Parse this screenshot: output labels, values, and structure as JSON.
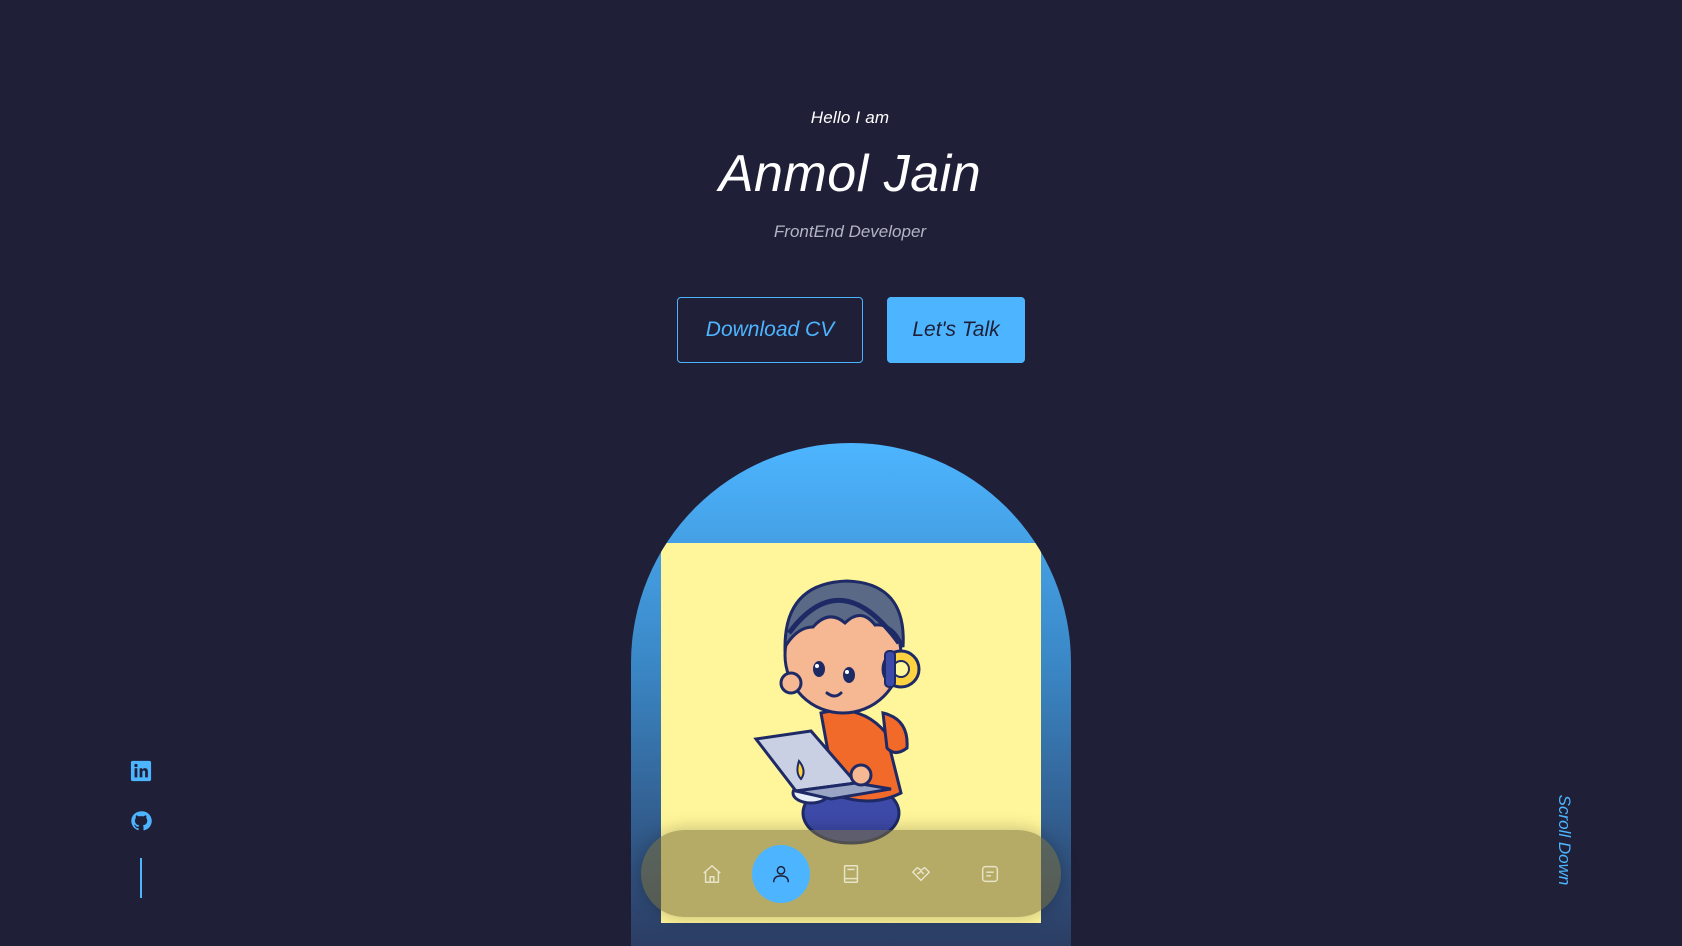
{
  "header": {
    "greeting": "Hello I am",
    "name": "Anmol Jain",
    "role": "FrontEnd Developer"
  },
  "cta": {
    "download_label": "Download CV",
    "talk_label": "Let's Talk"
  },
  "socials": [
    {
      "icon": "linkedin-icon"
    },
    {
      "icon": "github-icon"
    }
  ],
  "scroll": {
    "label": "Scroll Down"
  },
  "nav": {
    "items": [
      {
        "icon": "home-icon",
        "active": false
      },
      {
        "icon": "user-icon",
        "active": true
      },
      {
        "icon": "book-icon",
        "active": false
      },
      {
        "icon": "handshake-icon",
        "active": false
      },
      {
        "icon": "message-icon",
        "active": false
      }
    ]
  },
  "colors": {
    "background": "#1f1f38",
    "primary": "#4db5ff",
    "text": "#ffffff",
    "avatar_bg": "#fff59a"
  }
}
